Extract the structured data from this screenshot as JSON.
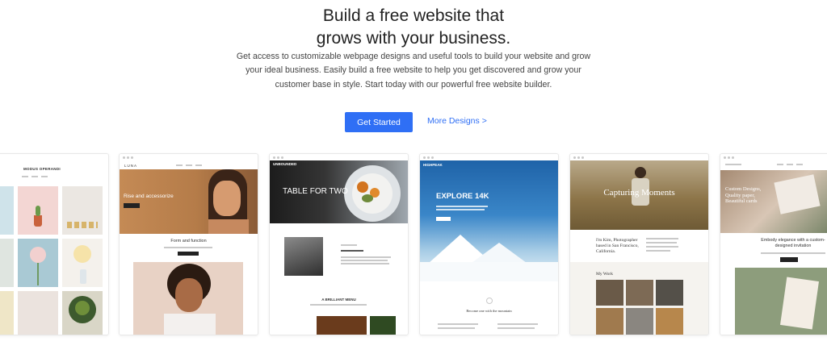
{
  "hero": {
    "title_line1": "Build a free website that",
    "title_line2": "grows with your business.",
    "description_lines": [
      "Get access to customizable webpage designs and useful tools to build your website and grow",
      "your ideal business. Easily build a free website to help you get discovered and grow your",
      "customer base in style. Start today with our powerful free website builder."
    ]
  },
  "cta": {
    "primary_label": "Get Started",
    "secondary_label": "More Designs >"
  },
  "templates": [
    {
      "name": "MODUS OPERANDI"
    },
    {
      "name": "LUNA",
      "hero_text": "Rise and accessorize",
      "section_title": "Form and function"
    },
    {
      "name": "UNBOUNDED",
      "hero_text": "TABLE FOR TWO",
      "section_title": "A BRILLIANT MENU"
    },
    {
      "name": "HIGHPEAK",
      "hero_text": "EXPLORE 14K",
      "section_caption": "Become one with the mountain"
    },
    {
      "hero_text": "Capturing Moments",
      "intro_text": "I'm Kim, Photographer based in San Francisco, California.",
      "section_title": "My Work"
    },
    {
      "hero_text": "Custom Designs, Quality paper, Beautiful cards",
      "section_title": "Embody elegance with a custom-designed invitation"
    }
  ],
  "colors": {
    "primary_button": "#2f6ff5",
    "link": "#2f6ff5",
    "title_text": "#222222",
    "body_text": "#444444"
  }
}
